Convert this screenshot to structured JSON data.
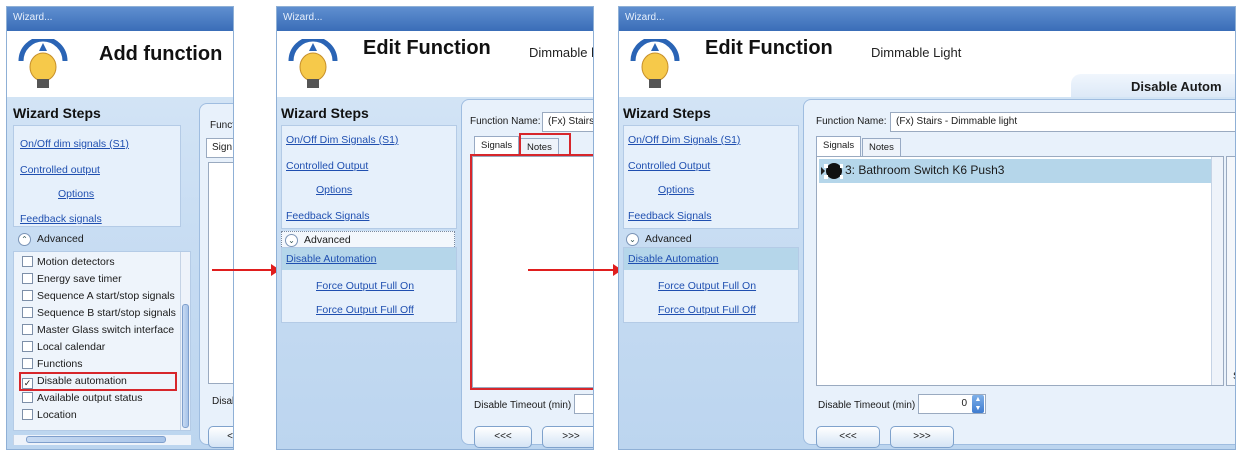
{
  "windows": [
    {
      "title": "Wizard...",
      "header_title": "Add function",
      "steps_title": "Wizard Steps",
      "steps": [
        "On/Off dim signals (S1)",
        "Controlled output",
        "Options",
        "Feedback signals"
      ],
      "advanced_label": "Advanced",
      "checklist": [
        {
          "label": "Motion detectors",
          "checked": false
        },
        {
          "label": "Energy save timer",
          "checked": false
        },
        {
          "label": "Sequence A start/stop signals",
          "checked": false
        },
        {
          "label": "Sequence B start/stop signals",
          "checked": false
        },
        {
          "label": "Master Glass switch interface",
          "checked": false
        },
        {
          "label": "Local calendar",
          "checked": false
        },
        {
          "label": "Functions",
          "checked": false
        },
        {
          "label": "Disable automation",
          "checked": true
        },
        {
          "label": "Available output status",
          "checked": false
        },
        {
          "label": "Location",
          "checked": false
        }
      ],
      "function_label": "Functi",
      "tab_partial": "Sign",
      "disable_partial": "Disab",
      "back_button": "<<"
    },
    {
      "title": "Wizard...",
      "header_title": "Edit Function",
      "header_sub": "Dimmable l",
      "steps_title": "Wizard Steps",
      "steps": [
        "On/Off Dim Signals (S1)",
        "Controlled Output",
        "Options",
        "Feedback Signals"
      ],
      "advanced_label": "Advanced",
      "advanced_steps": [
        "Disable Automation",
        "Force Output Full On",
        "Force Output Full Off"
      ],
      "function_name_label": "Function Name:",
      "function_name_value": "(Fx) Stairs",
      "tabs": [
        "Signals",
        "Notes"
      ],
      "disable_timeout_label": "Disable Timeout (min)",
      "back_button": "<<<",
      "next_button": ">>>"
    },
    {
      "title": "Wizard...",
      "header_title": "Edit Function",
      "header_sub": "Dimmable Light",
      "header_band": "Disable Autom",
      "steps_title": "Wizard Steps",
      "steps": [
        "On/Off Dim Signals (S1)",
        "Controlled Output",
        "Options",
        "Feedback Signals"
      ],
      "advanced_label": "Advanced",
      "advanced_steps": [
        "Disable Automation",
        "Force Output Full On",
        "Force Output Full Off"
      ],
      "function_name_label": "Function Name:",
      "function_name_value": "(Fx) Stairs - Dimmable light",
      "tabs": [
        "Signals",
        "Notes"
      ],
      "signal_item": "3: Bathroom Switch K6 Push3",
      "disable_timeout_label": "Disable Timeout (min)",
      "disable_timeout_value": "0",
      "scroll_partial": "S",
      "back_button": "<<<",
      "next_button": ">>>"
    }
  ],
  "colors": {
    "annotation": "#e01e1e",
    "selection": "#b5d6ea",
    "title_bar": "#3a6db8"
  }
}
